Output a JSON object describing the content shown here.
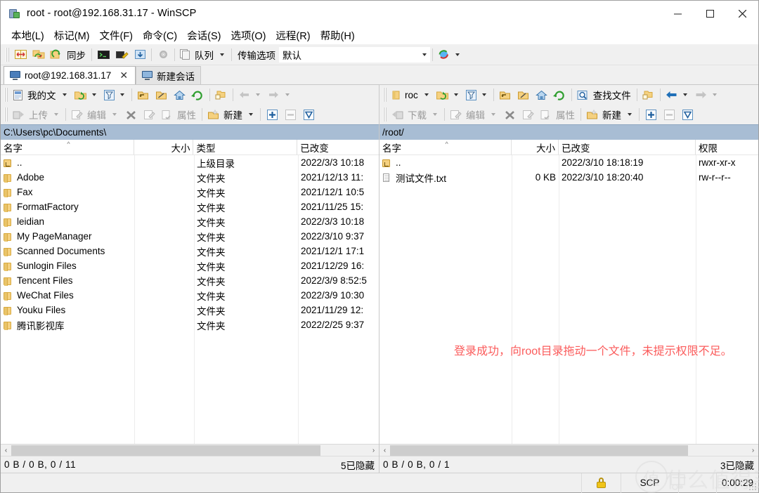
{
  "window": {
    "title": "root - root@192.168.31.17 - WinSCP",
    "icon": "winscp-lock-icon",
    "minimize_label": "—",
    "maximize_label": "□",
    "close_label": "✕"
  },
  "menu": {
    "items": [
      {
        "label": "本地(L)",
        "name": "menu-local"
      },
      {
        "label": "标记(M)",
        "name": "menu-mark"
      },
      {
        "label": "文件(F)",
        "name": "menu-file"
      },
      {
        "label": "命令(C)",
        "name": "menu-command"
      },
      {
        "label": "会话(S)",
        "name": "menu-session"
      },
      {
        "label": "选项(O)",
        "name": "menu-options"
      },
      {
        "label": "远程(R)",
        "name": "menu-remote"
      },
      {
        "label": "帮助(H)",
        "name": "menu-help"
      }
    ]
  },
  "toolbar": {
    "sync_label": "同步",
    "queue_label": "队列",
    "transfer_options_label": "传输选项",
    "transfer_options_value": "默认"
  },
  "tabs": {
    "items": [
      {
        "label": "root@192.168.31.17",
        "active": true,
        "close": "✕"
      },
      {
        "label": "新建会话",
        "active": false
      }
    ]
  },
  "left_panel": {
    "drive_label": "我的文",
    "path": "C:\\Users\\pc\\Documents\\",
    "upload_label": "上传",
    "edit_label": "编辑",
    "properties_label": "属性",
    "new_label": "新建",
    "columns": [
      "名字",
      "大小",
      "类型",
      "已改变"
    ],
    "rows": [
      {
        "name": "..",
        "icon": "up-directory-icon",
        "size": "",
        "type": "上级目录",
        "modified": "2022/3/3  10:18"
      },
      {
        "name": "Adobe",
        "icon": "folder-icon",
        "size": "",
        "type": "文件夹",
        "modified": "2021/12/13  11:"
      },
      {
        "name": "Fax",
        "icon": "folder-icon",
        "size": "",
        "type": "文件夹",
        "modified": "2021/12/1  10:5"
      },
      {
        "name": "FormatFactory",
        "icon": "folder-icon",
        "size": "",
        "type": "文件夹",
        "modified": "2021/11/25  15:"
      },
      {
        "name": "leidian",
        "icon": "folder-icon",
        "size": "",
        "type": "文件夹",
        "modified": "2022/3/3  10:18"
      },
      {
        "name": "My PageManager",
        "icon": "folder-icon",
        "size": "",
        "type": "文件夹",
        "modified": "2022/3/10  9:37"
      },
      {
        "name": "Scanned Documents",
        "icon": "folder-icon",
        "size": "",
        "type": "文件夹",
        "modified": "2021/12/1  17:1"
      },
      {
        "name": "Sunlogin Files",
        "icon": "folder-icon",
        "size": "",
        "type": "文件夹",
        "modified": "2021/12/29  16:"
      },
      {
        "name": "Tencent Files",
        "icon": "folder-icon",
        "size": "",
        "type": "文件夹",
        "modified": "2022/3/9  8:52:5"
      },
      {
        "name": "WeChat Files",
        "icon": "folder-icon",
        "size": "",
        "type": "文件夹",
        "modified": "2022/3/9  10:30"
      },
      {
        "name": "Youku Files",
        "icon": "folder-icon",
        "size": "",
        "type": "文件夹",
        "modified": "2021/11/29  12:"
      },
      {
        "name": "腾讯影视库",
        "icon": "folder-icon",
        "size": "",
        "type": "文件夹",
        "modified": "2022/2/25  9:37"
      }
    ],
    "status_left": "0 B / 0 B,  0 / 11",
    "status_right": "5已隐藏"
  },
  "right_panel": {
    "drive_label": "roc",
    "path": "/root/",
    "find_label": "查找文件",
    "download_label": "下载",
    "edit_label": "编辑",
    "properties_label": "属性",
    "new_label": "新建",
    "columns": [
      "名字",
      "大小",
      "已改变",
      "权限"
    ],
    "rows": [
      {
        "name": "..",
        "icon": "up-directory-icon",
        "size": "",
        "modified": "2022/3/10 18:18:19",
        "permissions": "rwxr-xr-x"
      },
      {
        "name": "测试文件.txt",
        "icon": "text-file-icon",
        "size": "0 KB",
        "modified": "2022/3/10 18:20:40",
        "permissions": "rw-r--r--"
      }
    ],
    "status_left": "0 B / 0 B,  0 / 1",
    "status_right": "3已隐藏",
    "annotation": "登录成功，向root目录拖动一个文件，未提示权限不足。",
    "annotation_color": "#fb5b5b"
  },
  "bottom_bar": {
    "lock_icon": "lock-icon",
    "protocol": "SCP",
    "elapsed": "0:00:29"
  },
  "watermark": {
    "logo_text": "值",
    "text": "什么值得买"
  }
}
